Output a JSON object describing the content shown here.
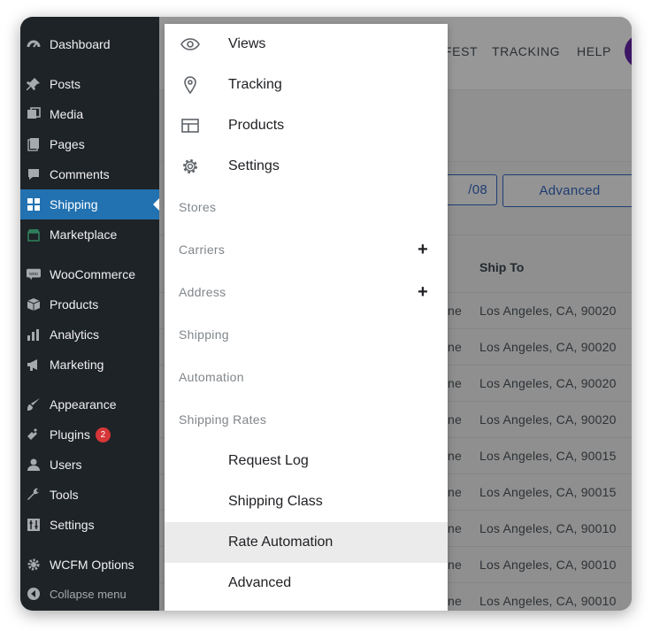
{
  "sidebar": {
    "items": [
      {
        "label": "Dashboard",
        "icon": "dashboard-icon"
      },
      {
        "label": "Posts",
        "icon": "pin-icon"
      },
      {
        "label": "Media",
        "icon": "media-icon"
      },
      {
        "label": "Pages",
        "icon": "pages-icon"
      },
      {
        "label": "Comments",
        "icon": "comment-icon"
      },
      {
        "label": "Shipping",
        "icon": "grid-icon",
        "active": true
      },
      {
        "label": "Marketplace",
        "icon": "store-icon"
      },
      {
        "label": "WooCommerce",
        "icon": "woo-icon"
      },
      {
        "label": "Products",
        "icon": "box-icon"
      },
      {
        "label": "Analytics",
        "icon": "bar-chart-icon"
      },
      {
        "label": "Marketing",
        "icon": "megaphone-icon"
      },
      {
        "label": "Appearance",
        "icon": "brush-icon"
      },
      {
        "label": "Plugins",
        "icon": "plug-icon",
        "badge": "2"
      },
      {
        "label": "Users",
        "icon": "user-icon"
      },
      {
        "label": "Tools",
        "icon": "wrench-icon"
      },
      {
        "label": "Settings",
        "icon": "settings-sliders-icon"
      },
      {
        "label": "WCFM Options",
        "icon": "gear-icon"
      }
    ],
    "collapse_label": "Collapse menu"
  },
  "topnav": {
    "manifest_partial": "FEST",
    "tracking": "TRACKING",
    "help": "HELP"
  },
  "buttons": {
    "date_partial": "/08",
    "advanced": "Advanced"
  },
  "table": {
    "header_ship_to": "Ship To",
    "rows": [
      {
        "c1": "ne",
        "ship_to": "Los Angeles, CA, 90020"
      },
      {
        "c1": "ne",
        "ship_to": "Los Angeles, CA, 90020"
      },
      {
        "c1": "ne",
        "ship_to": "Los Angeles, CA, 90020"
      },
      {
        "c1": "ne",
        "ship_to": "Los Angeles, CA, 90020"
      },
      {
        "c1": "ne",
        "ship_to": "Los Angeles, CA, 90015"
      },
      {
        "c1": "ne",
        "ship_to": "Los Angeles, CA, 90015"
      },
      {
        "c1": "ne",
        "ship_to": "Los Angeles, CA, 90010"
      },
      {
        "c1": "ne",
        "ship_to": "Los Angeles, CA, 90010"
      },
      {
        "c1": "ne",
        "ship_to": "Los Angeles, CA, 90010"
      }
    ]
  },
  "menu": {
    "items": [
      {
        "label": "Views",
        "icon": "eye-icon"
      },
      {
        "label": "Tracking",
        "icon": "location-pin-icon"
      },
      {
        "label": "Products",
        "icon": "table-layout-icon"
      },
      {
        "label": "Settings",
        "icon": "gear-icon"
      },
      {
        "label": "Stores",
        "section": true
      },
      {
        "label": "Carriers",
        "section": true,
        "expand": "+"
      },
      {
        "label": "Address",
        "section": true,
        "expand": "+"
      },
      {
        "label": "Shipping",
        "section": true
      },
      {
        "label": "Automation",
        "section": true
      },
      {
        "label": "Shipping Rates",
        "section": true
      },
      {
        "label": "Request Log"
      },
      {
        "label": "Shipping Class"
      },
      {
        "label": "Rate Automation",
        "highlighted": true
      },
      {
        "label": "Advanced"
      }
    ]
  }
}
